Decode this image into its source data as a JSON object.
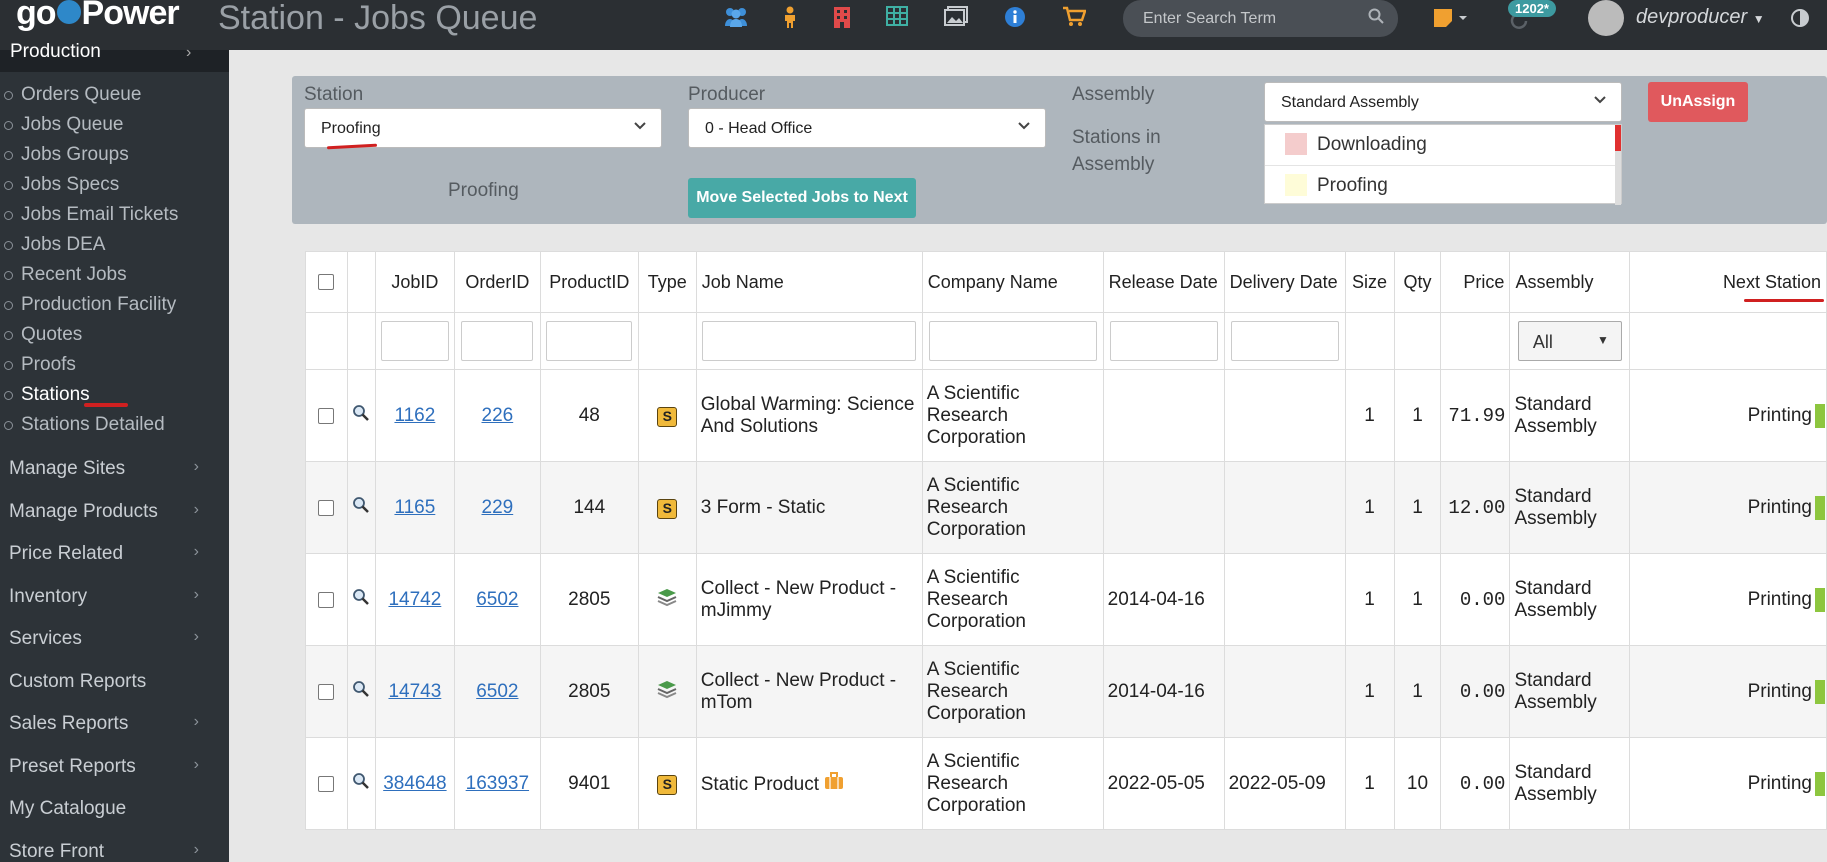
{
  "header": {
    "logo_prefix": "go",
    "logo_suffix": "Power",
    "page_title": "Station - Jobs Queue",
    "search_placeholder": "Enter Search Term",
    "notification_count": "1202*",
    "username": "devproducer"
  },
  "sidebar": {
    "section": "Production",
    "subitems": [
      {
        "label": "Orders Queue"
      },
      {
        "label": "Jobs Queue"
      },
      {
        "label": "Jobs Groups"
      },
      {
        "label": "Jobs Specs"
      },
      {
        "label": "Jobs Email Tickets"
      },
      {
        "label": "Jobs DEA"
      },
      {
        "label": "Recent Jobs"
      },
      {
        "label": "Production Facility"
      },
      {
        "label": "Quotes"
      },
      {
        "label": "Proofs"
      },
      {
        "label": "Stations"
      },
      {
        "label": "Stations Detailed"
      }
    ],
    "menu": [
      {
        "label": "Manage Sites",
        "chevron": "›"
      },
      {
        "label": "Manage Products",
        "chevron": "›"
      },
      {
        "label": "Price Related",
        "chevron": "›"
      },
      {
        "label": "Inventory",
        "chevron": "›"
      },
      {
        "label": "Services",
        "chevron": "›"
      },
      {
        "label": "Custom Reports",
        "chevron": ""
      },
      {
        "label": "Sales Reports",
        "chevron": "›"
      },
      {
        "label": "Preset Reports",
        "chevron": "›"
      },
      {
        "label": "My Catalogue",
        "chevron": ""
      },
      {
        "label": "Store Front",
        "chevron": "›"
      }
    ]
  },
  "panel": {
    "station_label": "Station",
    "station_value": "Proofing",
    "producer_label": "Producer",
    "producer_value": "0 - Head Office",
    "assembly_label": "Assembly",
    "assembly_value": "Standard Assembly",
    "stations_in_assembly_label": "Stations in Assembly",
    "current_station_text": "Proofing",
    "move_button": "Move Selected Jobs to Next",
    "unassign_button": "UnAssign",
    "assembly_stations": [
      {
        "name": "Downloading",
        "color": "#f4cccc"
      },
      {
        "name": "Proofing",
        "color": "#fefcd8"
      }
    ]
  },
  "table": {
    "headers": {
      "jobid": "JobID",
      "orderid": "OrderID",
      "productid": "ProductID",
      "type": "Type",
      "jobname": "Job Name",
      "company": "Company Name",
      "release": "Release Date",
      "delivery": "Delivery Date",
      "size": "Size",
      "qty": "Qty",
      "price": "Price",
      "assembly": "Assembly",
      "next": "Next Station"
    },
    "assembly_filter": "All",
    "rows": [
      {
        "jobid": "1162",
        "orderid": "226",
        "productid": "48",
        "type": "S",
        "jobname": "Global Warming: Science And Solutions",
        "company": "A Scientific Research Corporation",
        "release": "",
        "delivery": "",
        "size": "1",
        "qty": "1",
        "price": "71.99",
        "assembly": "Standard Assembly",
        "next": "Printing"
      },
      {
        "jobid": "1165",
        "orderid": "229",
        "productid": "144",
        "type": "S",
        "jobname": "3 Form - Static",
        "company": "A Scientific Research Corporation",
        "release": "",
        "delivery": "",
        "size": "1",
        "qty": "1",
        "price": "12.00",
        "assembly": "Standard Assembly",
        "next": "Printing"
      },
      {
        "jobid": "14742",
        "orderid": "6502",
        "productid": "2805",
        "type": "stack",
        "jobname": "Collect - New Product - mJimmy",
        "company": "A Scientific Research Corporation",
        "release": "2014-04-16",
        "delivery": "",
        "size": "1",
        "qty": "1",
        "price": "0.00",
        "assembly": "Standard Assembly",
        "next": "Printing"
      },
      {
        "jobid": "14743",
        "orderid": "6502",
        "productid": "2805",
        "type": "stack",
        "jobname": "Collect - New Product - mTom",
        "company": "A Scientific Research Corporation",
        "release": "2014-04-16",
        "delivery": "",
        "size": "1",
        "qty": "1",
        "price": "0.00",
        "assembly": "Standard Assembly",
        "next": "Printing"
      },
      {
        "jobid": "384648",
        "orderid": "163937",
        "productid": "9401",
        "type": "S",
        "jobname": "Static Product",
        "company": "A Scientific Research Corporation",
        "release": "2022-05-05",
        "delivery": "2022-05-09",
        "size": "1",
        "qty": "10",
        "price": "0.00",
        "assembly": "Standard Assembly",
        "next": "Printing"
      }
    ]
  }
}
